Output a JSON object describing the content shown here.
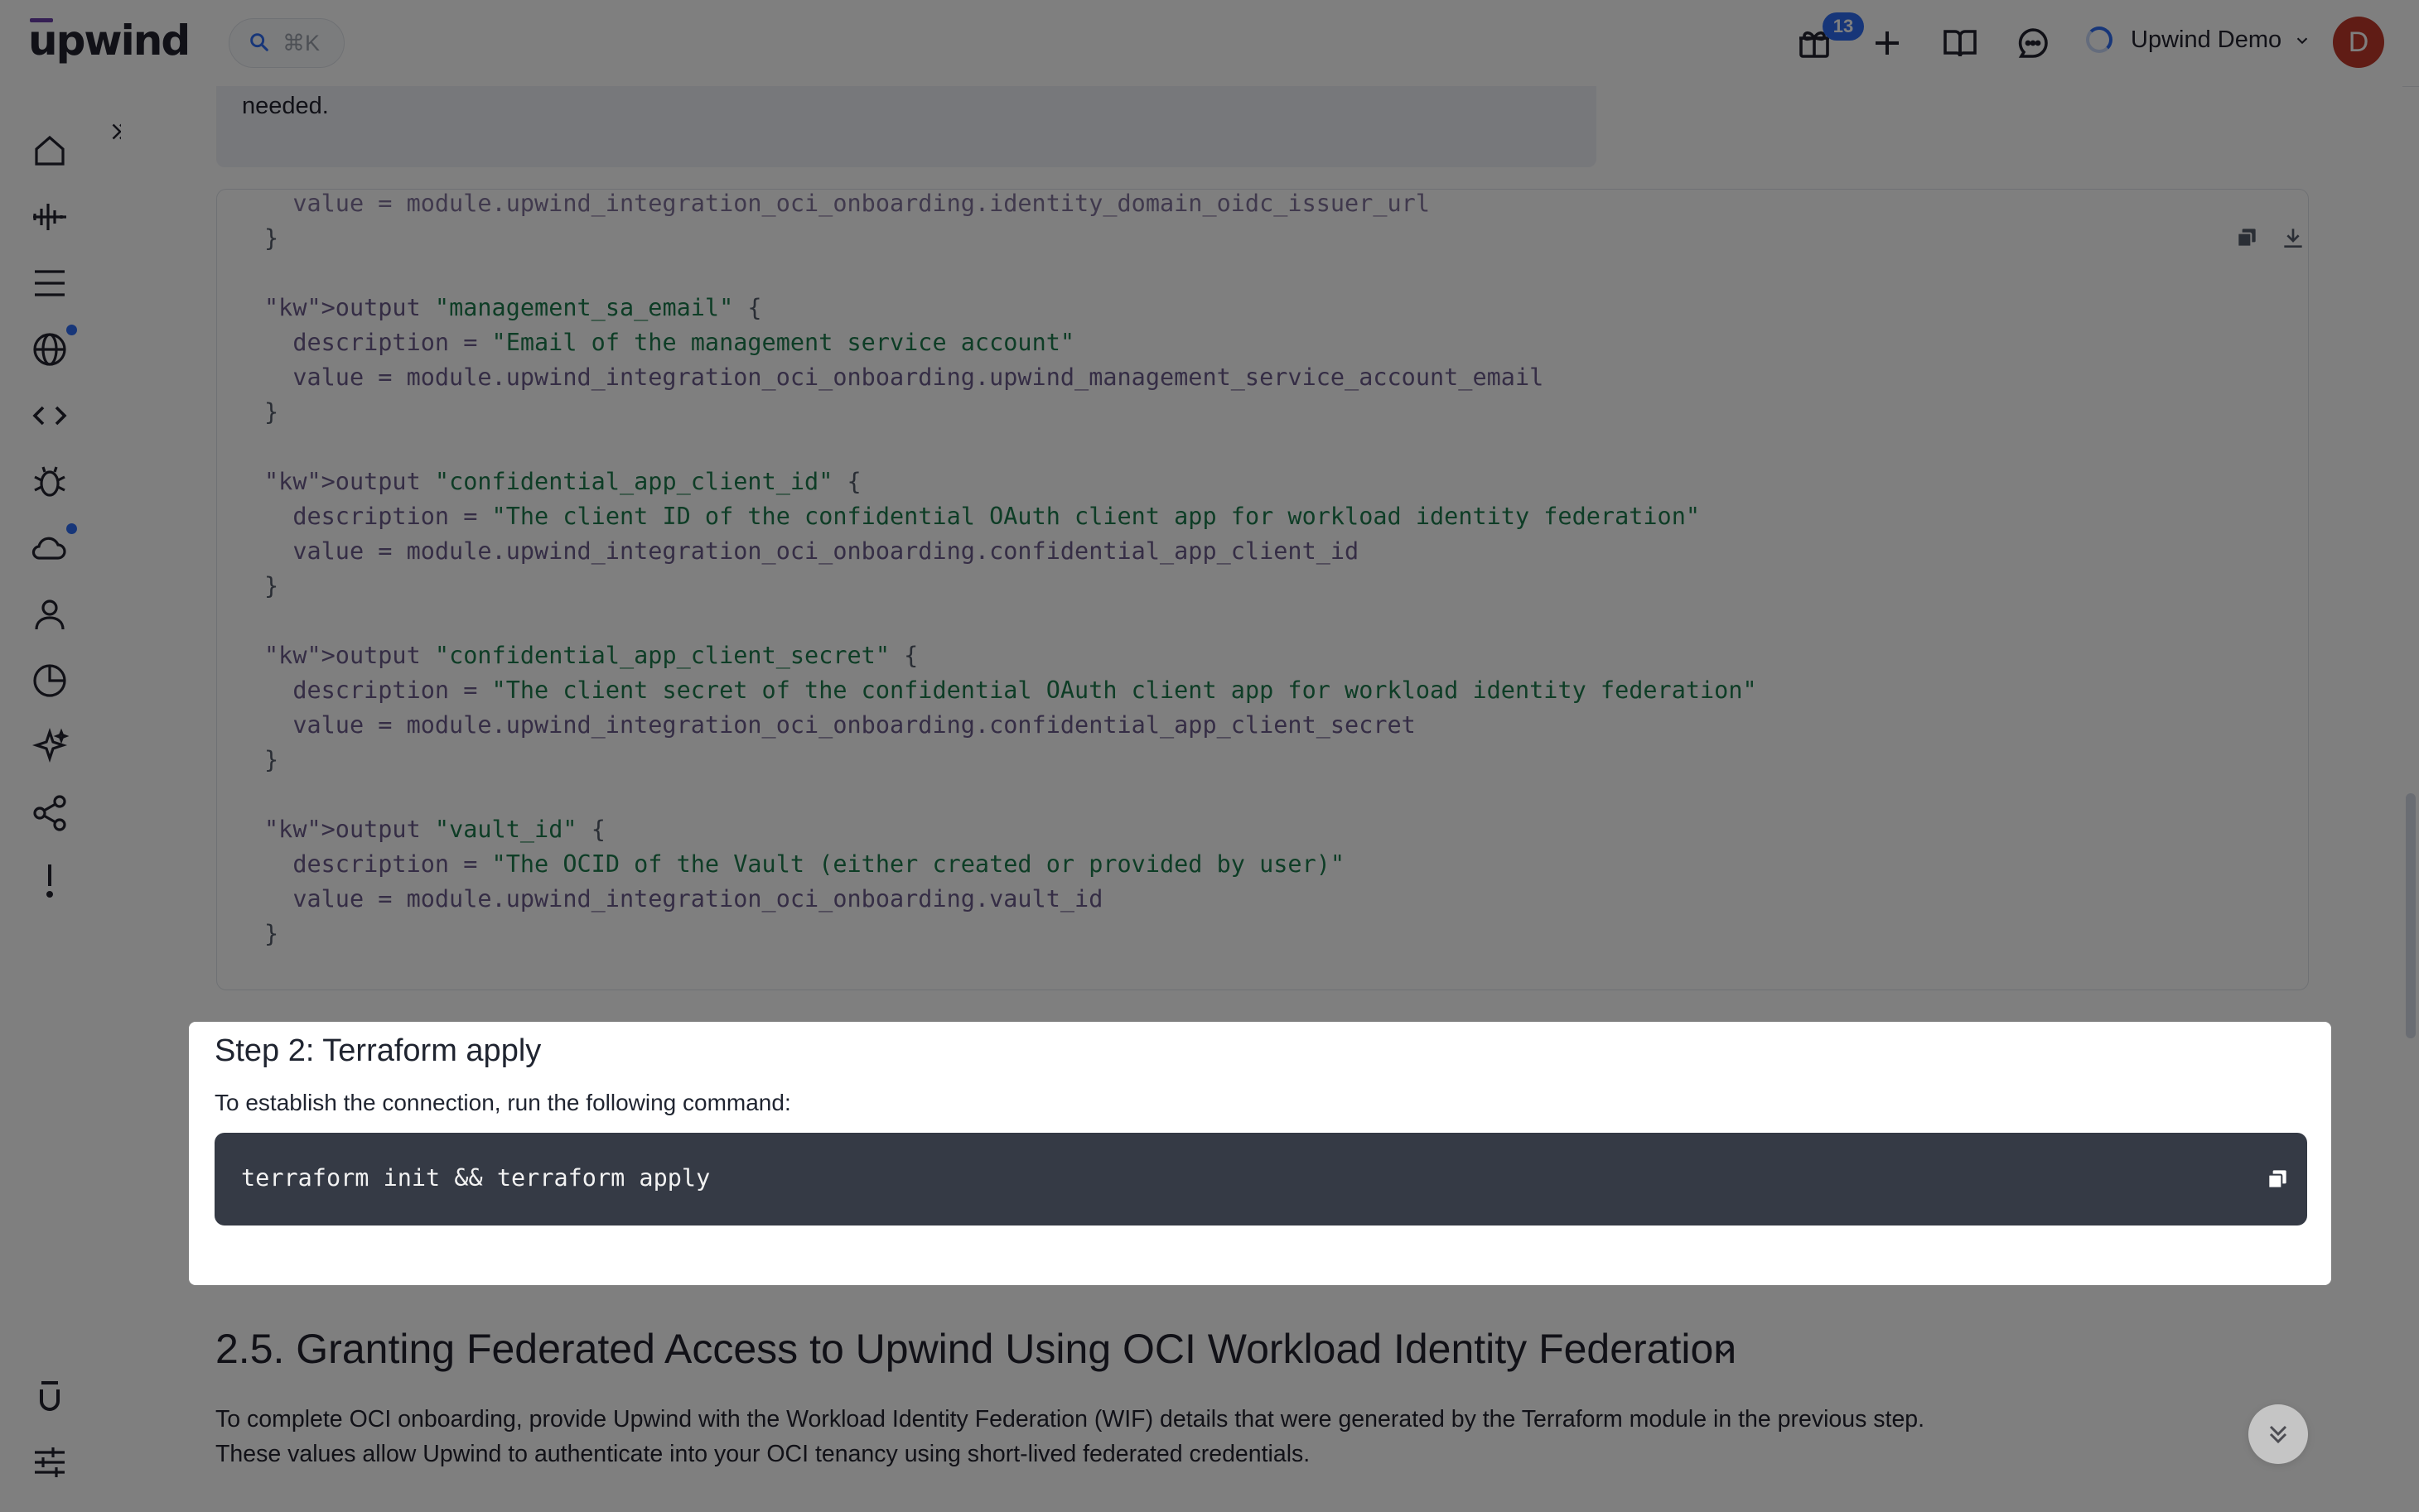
{
  "topbar": {
    "logo": "upwind",
    "search_shortcut": "⌘K",
    "notification_count": "13",
    "org_name": "Upwind Demo",
    "avatar_initial": "D"
  },
  "note": {
    "text": "needed."
  },
  "code": {
    "lines": [
      "  value = module.upwind_integration_oci_onboarding.identity_domain_oidc_issuer_url",
      "}",
      "",
      "output \"management_sa_email\" {",
      "  description = \"Email of the management service account\"",
      "  value = module.upwind_integration_oci_onboarding.upwind_management_service_account_email",
      "}",
      "",
      "output \"confidential_app_client_id\" {",
      "  description = \"The client ID of the confidential OAuth client app for workload identity federation\"",
      "  value = module.upwind_integration_oci_onboarding.confidential_app_client_id",
      "}",
      "",
      "output \"confidential_app_client_secret\" {",
      "  description = \"The client secret of the confidential OAuth client app for workload identity federation\"",
      "  value = module.upwind_integration_oci_onboarding.confidential_app_client_secret",
      "}",
      "",
      "output \"vault_id\" {",
      "  description = \"The OCID of the Vault (either created or provided by user)\"",
      "  value = module.upwind_integration_oci_onboarding.vault_id",
      "}"
    ]
  },
  "step2": {
    "title": "Step 2: Terraform apply",
    "description": "To establish the connection, run the following command:",
    "command": "terraform init && terraform apply"
  },
  "section": {
    "title": "2.5. Granting Federated Access to Upwind Using OCI Workload Identity Federation",
    "paragraph1": "To complete OCI onboarding, provide Upwind with the Workload Identity Federation (WIF) details that were generated by the Terraform module in the previous step.",
    "paragraph2": "These values allow Upwind to authenticate into your OCI tenancy using short-lived federated credentials."
  },
  "colors": {
    "accent": "#2f6df2",
    "avatar": "#c0392b",
    "code_keyword": "#1d7a4d",
    "code_prop": "#6b5a8a"
  }
}
